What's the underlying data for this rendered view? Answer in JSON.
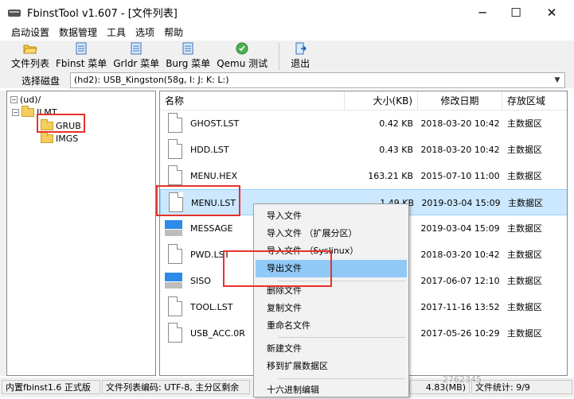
{
  "window": {
    "title": "FbinstTool v1.607 - [文件列表]",
    "min_symbol": "─",
    "max_symbol": "☐",
    "close_symbol": "✕"
  },
  "menu": [
    "启动设置",
    "数据管理",
    "工具",
    "选项",
    "帮助"
  ],
  "toolbar": {
    "buttons": [
      {
        "label": "文件列表",
        "icon": "folder-open-icon"
      },
      {
        "label": "Fbinst 菜单",
        "icon": "menu-doc-icon"
      },
      {
        "label": "Grldr 菜单",
        "icon": "menu-doc-icon"
      },
      {
        "label": "Burg 菜单",
        "icon": "menu-doc-icon"
      },
      {
        "label": "Qemu 测试",
        "icon": "qemu-icon"
      }
    ],
    "exit_label": "退出"
  },
  "disk": {
    "label": "选择磁盘",
    "value": "(hd2): USB_Kingston(58g, I: J: K: L:)"
  },
  "tree": {
    "root": "(ud)/",
    "toggle_minus": "−",
    "nodes": [
      "ILMT",
      "GRUB",
      "IMGS"
    ]
  },
  "list": {
    "headers": {
      "name": "名称",
      "size": "大小(KB)",
      "date": "修改日期",
      "area": "存放区域"
    },
    "rows": [
      {
        "name": "GHOST.LST",
        "size": "0.42 KB",
        "date": "2018-03-20 10:42",
        "area": "主数据区",
        "type": "doc"
      },
      {
        "name": "HDD.LST",
        "size": "0.43 KB",
        "date": "2018-03-20 10:42",
        "area": "主数据区",
        "type": "doc"
      },
      {
        "name": "MENU.HEX",
        "size": "163.21 KB",
        "date": "2015-07-10 11:00",
        "area": "主数据区",
        "type": "doc"
      },
      {
        "name": "MENU.LST",
        "size": "1.49 KB",
        "date": "2019-03-04 15:09",
        "area": "主数据区",
        "type": "doc"
      },
      {
        "name": "MESSAGE",
        "size": "",
        "date": "2019-03-04 15:09",
        "area": "主数据区",
        "type": "exe"
      },
      {
        "name": "PWD.LST",
        "size": "",
        "date": "2018-03-20 10:42",
        "area": "主数据区",
        "type": "doc"
      },
      {
        "name": "SISO",
        "size": "",
        "date": "2017-06-07 12:10",
        "area": "主数据区",
        "type": "exe"
      },
      {
        "name": "TOOL.LST",
        "size": "",
        "date": "2017-11-16 13:52",
        "area": "主数据区",
        "type": "doc"
      },
      {
        "name": "USB_ACC.0R",
        "size": "",
        "date": "2017-05-26 10:29",
        "area": "主数据区",
        "type": "doc"
      }
    ]
  },
  "context_menu": {
    "items": [
      "导入文件",
      "导入文件 （扩展分区）",
      "导入文件 （Syslinux）",
      "导出文件",
      "删除文件",
      "复制文件",
      "重命名文件",
      "新建文件",
      "移到扩展数据区",
      "十六进制编辑"
    ]
  },
  "status": {
    "left": "内置fbinst1.6 正式版",
    "middle": "文件列表编码: UTF-8, 主分区剩余",
    "right_size": "4.83(MB)",
    "count": "文件统计: 9/9"
  },
  "watermark": "2762345"
}
